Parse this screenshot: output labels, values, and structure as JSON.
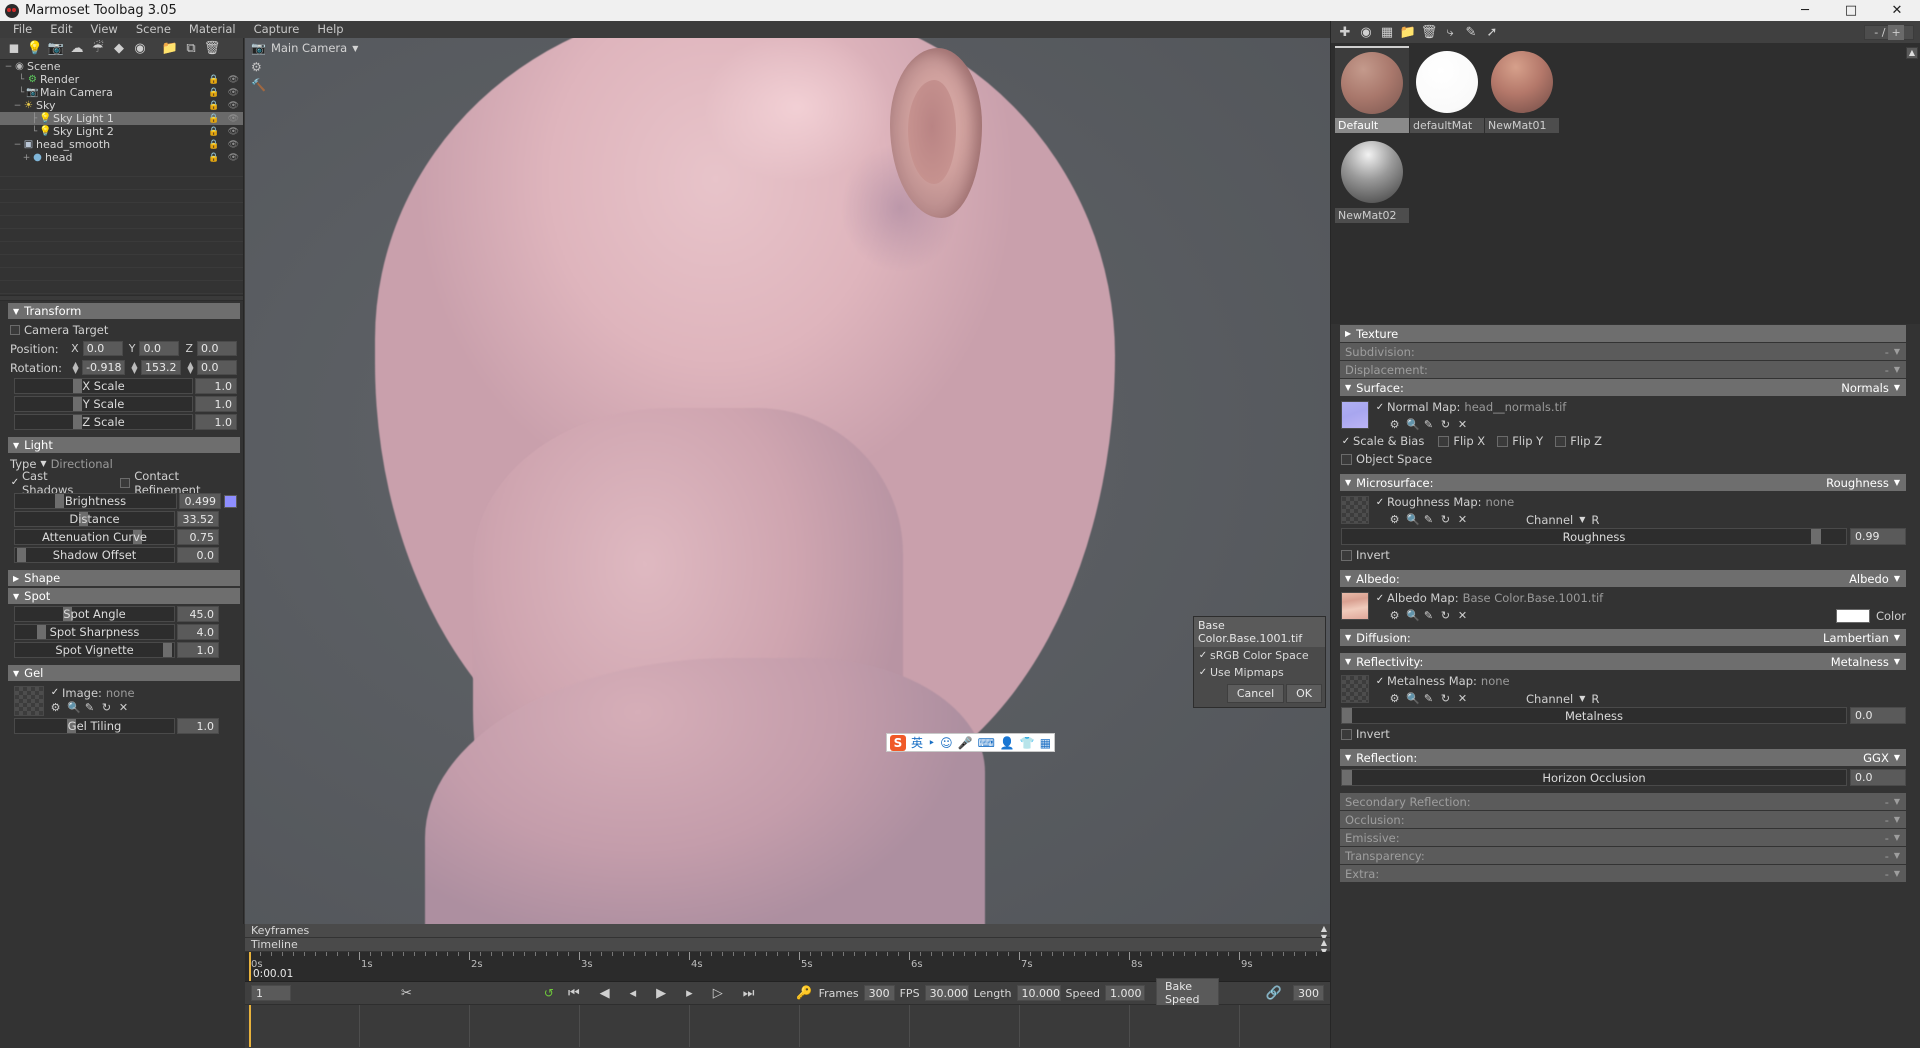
{
  "window": {
    "title": "Marmoset Toolbag 3.05",
    "app_icon": "marmoset-logo-icon",
    "minimize": "─",
    "maximize": "□",
    "close": "✕"
  },
  "menubar": {
    "items": [
      "File",
      "Edit",
      "View",
      "Scene",
      "Material",
      "Capture",
      "Help"
    ]
  },
  "left_toolbar": {
    "icons": [
      "mesh-icon",
      "light-icon",
      "camera-icon",
      "sky-icon",
      "fog-icon",
      "object-icon",
      "turntable-icon",
      "folder-icon",
      "duplicate-icon",
      "delete-icon"
    ]
  },
  "scene_tree": {
    "nodes": [
      {
        "label": "Scene",
        "icon": "scene-icon",
        "depth": 0,
        "toggle": "−",
        "selected": false
      },
      {
        "label": "Render",
        "icon": "render-icon",
        "depth": 1,
        "toggle": "",
        "selected": false
      },
      {
        "label": "Main Camera",
        "icon": "camera-icon",
        "depth": 1,
        "toggle": "",
        "selected": false
      },
      {
        "label": "Sky",
        "icon": "sky-icon",
        "depth": 1,
        "toggle": "−",
        "selected": false
      },
      {
        "label": "Sky Light 1",
        "icon": "bulb-icon",
        "depth": 2,
        "toggle": "",
        "selected": true
      },
      {
        "label": "Sky Light 2",
        "icon": "bulb-icon",
        "depth": 2,
        "toggle": "",
        "selected": false
      },
      {
        "label": "head_smooth",
        "icon": "mesh-icon",
        "depth": 1,
        "toggle": "−",
        "selected": false
      },
      {
        "label": "head",
        "icon": "object-icon",
        "depth": 2,
        "toggle": "+",
        "selected": false
      }
    ],
    "lock_icon": "lock-icon",
    "visibility_icon": "eye-icon"
  },
  "transform": {
    "title": "Transform",
    "camera_target_label": "Camera Target",
    "camera_target_checked": false,
    "position_label": "Position:",
    "rotation_label": "Rotation:",
    "axes": [
      "X",
      "Y",
      "Z"
    ],
    "position": [
      "0.0",
      "0.0",
      "0.0"
    ],
    "rotation": [
      "-0.918",
      "153.2",
      "0.0"
    ],
    "scales": [
      {
        "label": "X Scale",
        "value": "1.0",
        "knob_pct": 33
      },
      {
        "label": "Y Scale",
        "value": "1.0",
        "knob_pct": 33
      },
      {
        "label": "Z Scale",
        "value": "1.0",
        "knob_pct": 33
      }
    ]
  },
  "light": {
    "title": "Light",
    "type_label": "Type",
    "type_value": "Directional",
    "cast_shadows_label": "Cast Shadows",
    "cast_shadows_checked": true,
    "contact_refinement_label": "Contact Refinement",
    "contact_refinement_checked": false,
    "sliders": [
      {
        "label": "Brightness",
        "value": "0.499",
        "knob_pct": 25,
        "swatch": "#8e8eff"
      },
      {
        "label": "Distance",
        "value": "33.52",
        "knob_pct": 40,
        "swatch": null
      },
      {
        "label": "Attenuation Curve",
        "value": "0.75",
        "knob_pct": 75,
        "swatch": null
      },
      {
        "label": "Shadow Offset",
        "value": "0.0",
        "knob_pct": 2,
        "swatch": null
      }
    ]
  },
  "shape": {
    "title": "Shape",
    "collapsed": true
  },
  "spot": {
    "title": "Spot",
    "sliders": [
      {
        "label": "Spot Angle",
        "value": "45.0",
        "knob_pct": 30
      },
      {
        "label": "Spot Sharpness",
        "value": "4.0",
        "knob_pct": 14
      },
      {
        "label": "Spot Vignette",
        "value": "1.0",
        "knob_pct": 94
      }
    ]
  },
  "gel": {
    "title": "Gel",
    "image_label": "Image:",
    "image_value": "none",
    "image_checked": true,
    "icons": [
      "gear-icon",
      "search-icon",
      "pencil-icon",
      "reload-icon",
      "close-icon"
    ],
    "tiling": {
      "label": "Gel Tiling",
      "value": "1.0",
      "knob_pct": 33
    }
  },
  "viewport": {
    "camera_label": "Main Camera",
    "camera_icon": "camera-icon",
    "dropdown_icon": "chevron-down-icon",
    "side_icons": [
      "gear-icon",
      "wrench-icon"
    ]
  },
  "texture_dialog": {
    "title": "Base Color.Base.1001.tif",
    "options": [
      {
        "label": "sRGB Color Space",
        "checked": true
      },
      {
        "label": "Use Mipmaps",
        "checked": true
      }
    ],
    "cancel": "Cancel",
    "ok": "OK"
  },
  "ime_bar": {
    "logo": "S",
    "icons": [
      "lang-chinese-icon",
      "punctuation-icon",
      "emoji-icon",
      "microphone-icon",
      "keyboard-icon",
      "user-icon",
      "skin-icon",
      "apps-icon"
    ],
    "chinese_label": "英"
  },
  "material_toolbar": {
    "icons": [
      "add-icon",
      "duplicate-material-icon",
      "transparent-icon",
      "folder-icon",
      "trash-icon",
      "assign-icon",
      "edit-icon",
      "link-icon"
    ],
    "counter": "- /",
    "counter_plus": "+"
  },
  "materials": {
    "items": [
      {
        "name": "Default",
        "sphere": "sp-default",
        "selected": true
      },
      {
        "name": "defaultMat",
        "sphere": "sp-white",
        "selected": false
      },
      {
        "name": "NewMat01",
        "sphere": "sp-copper",
        "selected": false
      },
      {
        "name": "NewMat02",
        "sphere": "sp-metal",
        "selected": false
      }
    ]
  },
  "material_props": {
    "texture": {
      "title": "Texture",
      "collapsed": true
    },
    "subdivision": {
      "title": "Subdivision:",
      "value": "-",
      "dim": true
    },
    "displacement": {
      "title": "Displacement:",
      "value": "-",
      "dim": true
    },
    "surface": {
      "title": "Surface:",
      "value": "Normals",
      "map_label": "Normal Map:",
      "map_value": "head__normals.tif",
      "map_checked": true,
      "icons": [
        "gear-icon",
        "search-icon",
        "pencil-icon",
        "reload-icon",
        "close-icon"
      ],
      "scale_bias_label": "Scale & Bias",
      "scale_bias_checked": true,
      "flip_x": "Flip X",
      "flip_y": "Flip Y",
      "flip_z": "Flip Z",
      "object_space_label": "Object Space",
      "object_space_checked": false
    },
    "microsurface": {
      "title": "Microsurface:",
      "value": "Roughness",
      "map_label": "Roughness Map:",
      "map_value": "none",
      "map_checked": true,
      "channel_label": "Channel",
      "channel_value": "R",
      "slider_label": "Roughness",
      "slider_value": "0.99",
      "knob_pct": 93,
      "invert_label": "Invert",
      "invert_checked": false
    },
    "albedo": {
      "title": "Albedo:",
      "value": "Albedo",
      "map_label": "Albedo Map:",
      "map_value": "Base Color.Base.1001.tif",
      "map_checked": true,
      "color_label": "Color",
      "color_value": "#ffffff"
    },
    "diffusion": {
      "title": "Diffusion:",
      "value": "Lambertian"
    },
    "reflectivity": {
      "title": "Reflectivity:",
      "value": "Metalness",
      "map_label": "Metalness Map:",
      "map_value": "none",
      "map_checked": true,
      "channel_label": "Channel",
      "channel_value": "R",
      "slider_label": "Metalness",
      "slider_value": "0.0",
      "knob_pct": 1,
      "invert_label": "Invert",
      "invert_checked": false
    },
    "reflection": {
      "title": "Reflection:",
      "value": "GGX",
      "slider_label": "Horizon Occlusion",
      "slider_value": "0.0",
      "knob_pct": 1
    },
    "secondary_reflection": {
      "title": "Secondary Reflection:",
      "value": "-",
      "dim": true
    },
    "occlusion": {
      "title": "Occlusion:",
      "value": "-",
      "dim": true
    },
    "emissive": {
      "title": "Emissive:",
      "value": "-",
      "dim": true
    },
    "transparency": {
      "title": "Transparency:",
      "value": "-",
      "dim": true
    },
    "extra": {
      "title": "Extra:",
      "value": "-",
      "dim": true
    }
  },
  "timeline": {
    "keyframes_label": "Keyframes",
    "timeline_label": "Timeline",
    "ticks": [
      "0s",
      "1s",
      "2s",
      "3s",
      "4s",
      "5s",
      "6s",
      "7s",
      "8s",
      "9s"
    ],
    "current_time": "0:00.01",
    "frame_value": "1",
    "scissors_icon": "scissors-icon",
    "transport_icons": [
      "loop-icon",
      "skip-back-icon",
      "step-back-icon",
      "prev-frame-icon",
      "play-icon",
      "next-frame-icon",
      "step-forward-icon",
      "skip-forward-icon"
    ],
    "key-icon": "key-icon",
    "frames_label": "Frames",
    "frames_value": "300",
    "fps_label": "FPS",
    "fps_value": "30.000",
    "length_label": "Length",
    "length_value": "10.000",
    "speed_label": "Speed",
    "speed_value": "1.000",
    "bake_speed_label": "Bake Speed",
    "link_icon": "link-icon",
    "end_frame_value": "300"
  }
}
